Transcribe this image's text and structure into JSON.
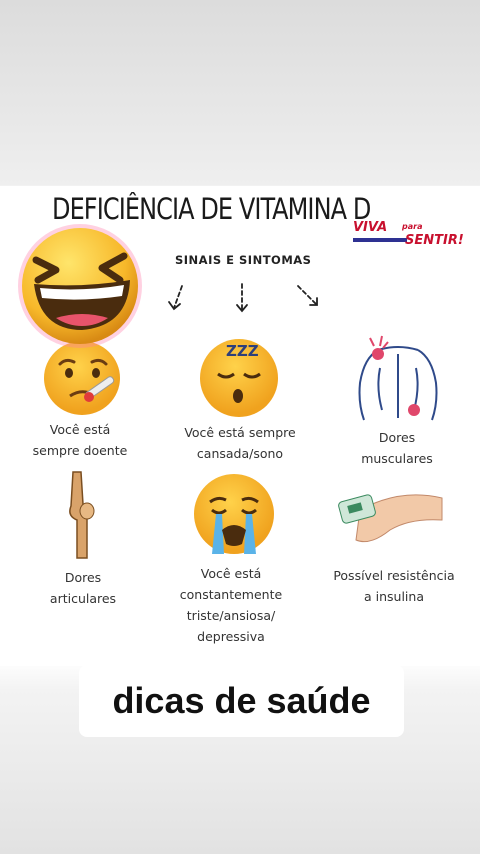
{
  "header": {
    "title": "DEFICIÊNCIA DE VITAMINA D",
    "subtitle": "SINAIS E SINTOMAS"
  },
  "logo": {
    "line1": "VIVA",
    "small": "para",
    "line2": "SENTIR!"
  },
  "symptoms": [
    {
      "text_line1": "Você está",
      "text_line2": "sempre doente"
    },
    {
      "text_line1": "Você está sempre",
      "text_line2": "cansada/sono"
    },
    {
      "text_line1": "Dores",
      "text_line2": "musculares"
    },
    {
      "text_line1": "Dores",
      "text_line2": "articulares"
    },
    {
      "text_line1": "Você está",
      "text_line2": "constantemente",
      "text_line3": "triste/ansiosa/",
      "text_line4": "depressiva"
    },
    {
      "text_line1": "Possível resistência",
      "text_line2": "a insulina"
    }
  ],
  "sleep_letters": "ZZZ",
  "overlay": {
    "caption": "dicas de saúde",
    "sticker": "laughing-emoji"
  }
}
